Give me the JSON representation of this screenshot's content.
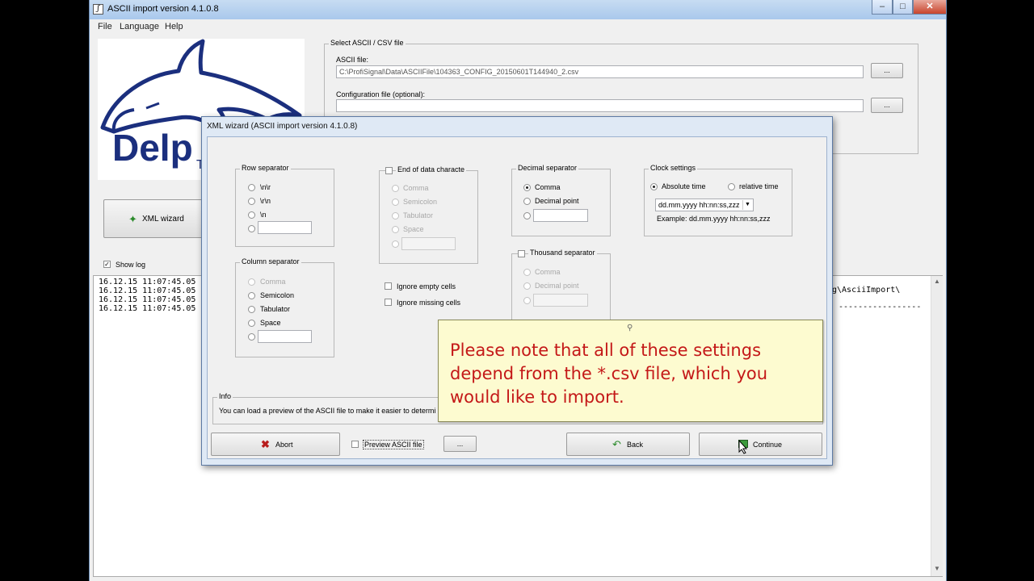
{
  "window": {
    "title": "ASCII import version 4.1.0.8",
    "min": "–",
    "max": "□",
    "close": "✕"
  },
  "menu": [
    "File",
    "Language",
    "Help"
  ],
  "logo_text": "Delp",
  "logo_sub": "T",
  "left_panel": {
    "xml_wizard_label": "XML wizard",
    "show_log_label": "Show log",
    "show_log_checked": true
  },
  "select_group": {
    "title": "Select ASCII / CSV file",
    "ascii_label": "ASCII file:",
    "ascii_value": "C:\\ProfiSignal\\Data\\ASCIIFile\\104363_CONFIG_20150601T144940_2.csv",
    "config_label": "Configuration file (optional):",
    "config_value": "",
    "browse_label": "..."
  },
  "log": {
    "lines": [
      "16.12.15 11:07:45.05",
      "16.12.15 11:07:45.05",
      "16.12.15 11:07:45.05",
      "16.12.15 11:07:45.05"
    ],
    "right_text": "g\\AsciiImport\\",
    "dash_line": "-----------------"
  },
  "dialog": {
    "title": "XML wizard (ASCII import version 4.1.0.8)",
    "row_separator": {
      "title": "Row separator",
      "options": [
        "\\n\\r",
        "\\r\\n",
        "\\n"
      ]
    },
    "column_separator": {
      "title": "Column separator",
      "options": [
        "Comma",
        "Semicolon",
        "Tabulator",
        "Space"
      ]
    },
    "end_of_data": {
      "title": "End of data characte",
      "options": [
        "Comma",
        "Semicolon",
        "Tabulator",
        "Space"
      ]
    },
    "ignore_empty": "Ignore empty cells",
    "ignore_missing": "Ignore missing cells",
    "decimal_separator": {
      "title": "Decimal separator",
      "options": [
        "Comma",
        "Decimal point"
      ],
      "selected": "Comma"
    },
    "thousand_separator": {
      "title": "Thousand separator",
      "options": [
        "Comma",
        "Decimal point"
      ]
    },
    "clock": {
      "title": "Clock settings",
      "absolute": "Absolute time",
      "relative": "relative time",
      "selected": "Absolute time",
      "format": "dd.mm.yyyy hh:nn:ss,zzz",
      "example": "Example: dd.mm.yyyy hh:nn:ss,zzz"
    },
    "info": {
      "title": "Info",
      "text": "You can load a preview of the ASCII file to make it easier to determi"
    },
    "buttons": {
      "abort": "Abort",
      "preview": "Preview ASCII file",
      "browse": "...",
      "back": "Back",
      "continue": "Continue"
    }
  },
  "note": "Please note that all of these settings depend from the *.csv file, which you would like to import."
}
